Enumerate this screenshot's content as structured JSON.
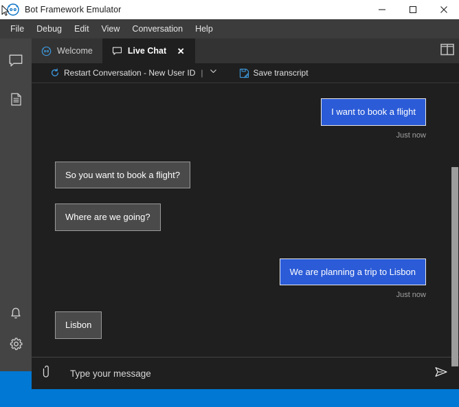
{
  "window": {
    "title": "Bot Framework Emulator",
    "logo_icon": "bot-logo-icon",
    "minimize_label": "Minimize",
    "maximize_label": "Maximize",
    "close_label": "Close"
  },
  "menubar": {
    "items": [
      {
        "label": "File",
        "name": "menu-file"
      },
      {
        "label": "Debug",
        "name": "menu-debug"
      },
      {
        "label": "Edit",
        "name": "menu-edit"
      },
      {
        "label": "View",
        "name": "menu-view"
      },
      {
        "label": "Conversation",
        "name": "menu-conversation"
      },
      {
        "label": "Help",
        "name": "menu-help"
      }
    ]
  },
  "rail": {
    "items": [
      {
        "name": "rail-item-chat",
        "icon": "chat-bubble-icon"
      },
      {
        "name": "rail-item-resources",
        "icon": "document-icon"
      },
      {
        "name": "rail-item-notifications",
        "icon": "bell-icon"
      },
      {
        "name": "rail-item-settings",
        "icon": "gear-icon"
      }
    ]
  },
  "tabs": {
    "items": [
      {
        "label": "Welcome",
        "icon": "bot-circle-icon",
        "active": false,
        "closable": false
      },
      {
        "label": "Live Chat",
        "icon": "chat-bubble-icon",
        "active": true,
        "closable": true
      }
    ],
    "close_glyph": "✕",
    "panel_toggle_icon": "split-panel-icon"
  },
  "chat_toolbar": {
    "restart_label": "Restart Conversation - New User ID",
    "restart_icon": "restart-circular-arrow-icon",
    "divider": "|",
    "caret_icon": "chevron-down-icon",
    "save_label": "Save transcript",
    "save_icon": "save-transcript-icon"
  },
  "transcript": {
    "messages": [
      {
        "from": "user",
        "text": "I want to book a flight",
        "timestamp": "Just now"
      },
      {
        "from": "bot",
        "text": "So you want to book a flight?",
        "timestamp": ""
      },
      {
        "from": "bot",
        "text": "Where are we going?",
        "timestamp": ""
      },
      {
        "from": "user",
        "text": "We are planning a trip to Lisbon",
        "timestamp": "Just now"
      },
      {
        "from": "bot",
        "text": "Lisbon",
        "timestamp": ""
      }
    ]
  },
  "composer": {
    "attach_icon": "paperclip-icon",
    "placeholder": "Type your message",
    "value": "",
    "send_icon": "send-paper-plane-icon"
  },
  "statusbar": {
    "text": ""
  },
  "colors": {
    "accent_blue": "#0078d4",
    "user_bubble": "#2b5bd7",
    "bot_bubble": "#4a4a4a",
    "chrome_dark": "#1f1f1f",
    "rail": "#444444",
    "tabstrip": "#333333",
    "menubar": "#3c3c3c"
  }
}
